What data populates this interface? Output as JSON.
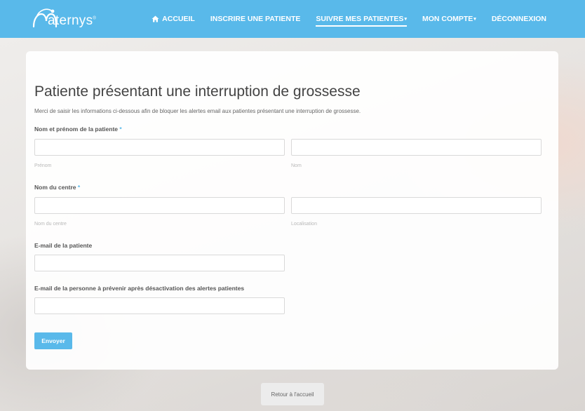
{
  "brand": {
    "name": "aternys",
    "logo_icon": "maternys-logo-icon",
    "registered": "®",
    "primary_color": "#59b9ea"
  },
  "nav": {
    "items": [
      {
        "label": "ACCUEIL",
        "icon": "home-icon"
      },
      {
        "label": "INSCRIRE UNE PATIENTE"
      },
      {
        "label": "SUIVRE MES PATIENTES",
        "dropdown": true,
        "active": true
      },
      {
        "label": "MON COMPTE",
        "dropdown": true
      },
      {
        "label": "DÉCONNEXION"
      }
    ],
    "caret": "▾"
  },
  "form": {
    "title": "Patiente présentant une interruption de grossesse",
    "subtitle": "Merci de saisir les informations ci-dessous afin de bloquer les alertes email aux patientes présentant une interruption de grossesse.",
    "required_mark": "*",
    "patient_name": {
      "label": "Nom et prénom de la patiente",
      "first_hint": "Prénom",
      "last_hint": "Nom",
      "first_value": "",
      "last_value": ""
    },
    "center": {
      "label": "Nom du centre",
      "name_hint": "Nom du centre",
      "location_hint": "Localisation",
      "name_value": "",
      "location_value": ""
    },
    "patient_email": {
      "label": "E-mail de la patiente",
      "value": ""
    },
    "contact_email": {
      "label": "E-mail de la personne à prévenir après désactivation des alertes patientes",
      "value": ""
    },
    "submit_label": "Envoyer"
  },
  "footer": {
    "back_label": "Retour à l'accueil"
  }
}
